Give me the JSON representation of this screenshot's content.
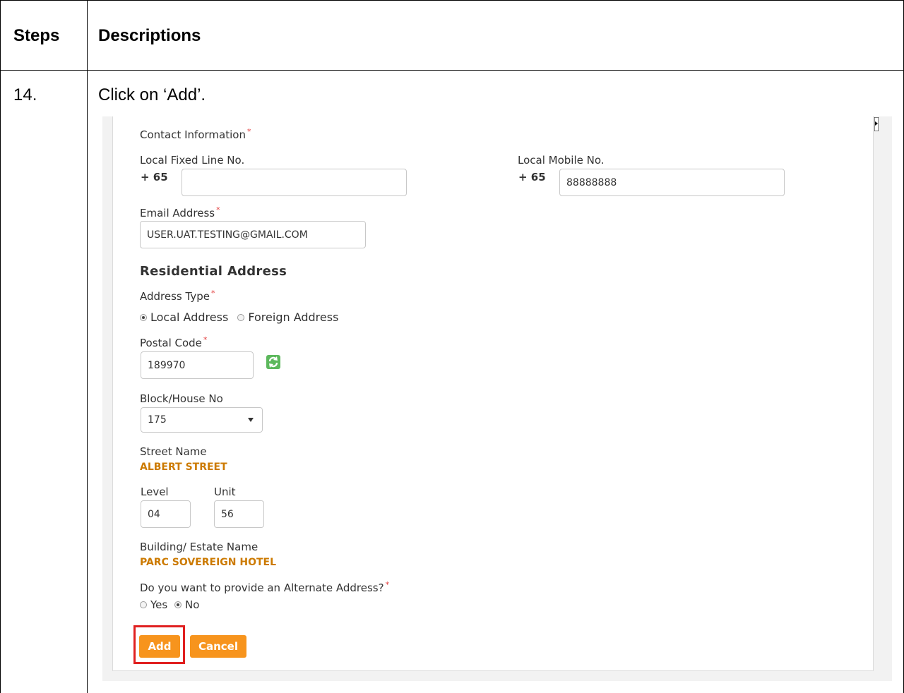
{
  "table": {
    "headers": {
      "steps": "Steps",
      "descriptions": "Descriptions"
    },
    "row": {
      "step": "14.",
      "description": "Click on ‘Add’."
    }
  },
  "form": {
    "contact_label": "Contact Information",
    "fixed_label": "Local Fixed Line No.",
    "fixed_prefix": "+  65",
    "fixed_value": "",
    "mobile_label": "Local Mobile No.",
    "mobile_prefix": "+  65",
    "mobile_value": "88888888",
    "email_label": "Email Address",
    "email_value": "USER.UAT.TESTING@GMAIL.COM",
    "residential_heading": "Residential Address",
    "address_type_label": "Address Type",
    "address_type_options": [
      "Local Address",
      "Foreign Address"
    ],
    "address_type_selected": "Local Address",
    "postal_label": "Postal Code",
    "postal_value": "189970",
    "block_label": "Block/House No",
    "block_value": "175",
    "street_label": "Street Name",
    "street_value": "ALBERT STREET",
    "level_label": "Level",
    "level_value": "04",
    "unit_label": "Unit",
    "unit_value": "56",
    "building_label": "Building/ Estate Name",
    "building_value": "PARC SOVEREIGN HOTEL",
    "alternate_label": "Do you want to provide an Alternate Address?",
    "alternate_options": [
      "Yes",
      "No"
    ],
    "alternate_selected": "No",
    "add_label": "Add",
    "cancel_label": "Cancel",
    "required_mark": "*"
  },
  "colors": {
    "button": "#f7941d",
    "highlight": "#e02020",
    "value_text": "#cc7a00",
    "refresh_icon": "#5cb85c"
  }
}
